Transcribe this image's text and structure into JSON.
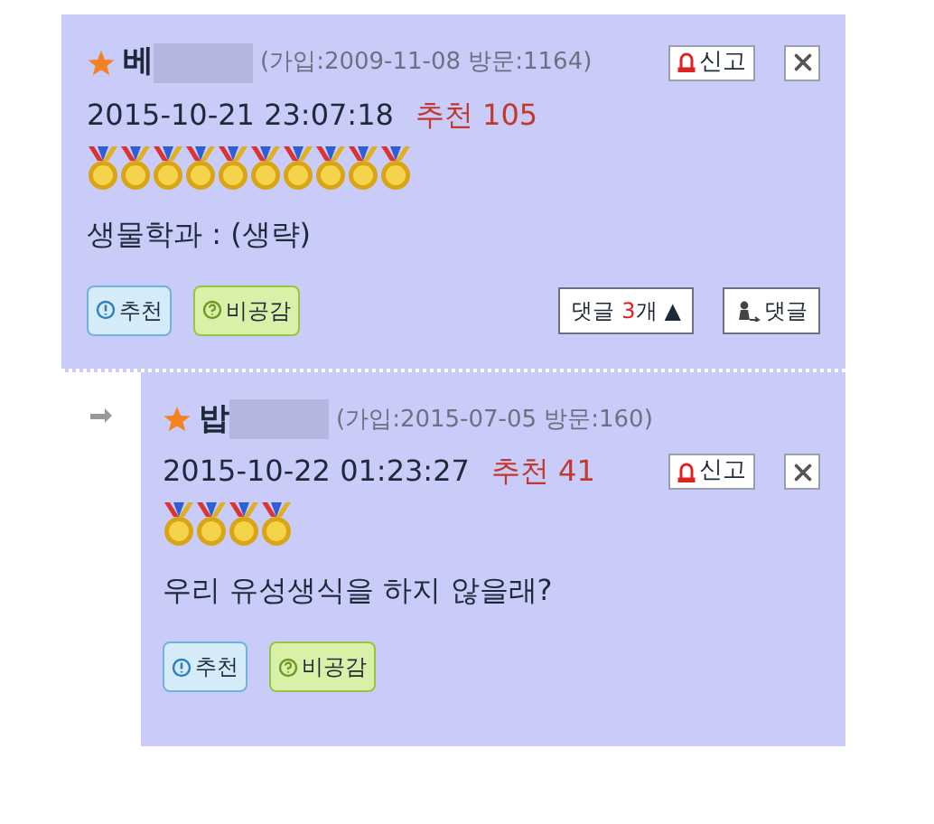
{
  "comments": [
    {
      "author": "베",
      "joined": "(가입:2009-11-08 방문:1164)",
      "datetime": "2015-10-21 23:07:18",
      "recommend_label": "추천 105",
      "medals": [
        {
          "kind": "medal"
        },
        {
          "kind": "medal"
        },
        {
          "kind": "medal"
        },
        {
          "kind": "medal"
        },
        {
          "kind": "medal"
        },
        {
          "kind": "medal"
        },
        {
          "kind": "medal"
        },
        {
          "kind": "medal"
        },
        {
          "kind": "medal"
        },
        {
          "kind": "medal"
        }
      ],
      "body": "생물학과 : (생략)",
      "report": "신고",
      "upvote": "추천",
      "downvote": "비공감",
      "reply_count": {
        "label": "댓글",
        "count": "3",
        "unit": "개",
        "arrow": "▲"
      },
      "reply_button": "댓글"
    },
    {
      "author": "밥",
      "joined": "(가입:2015-07-05 방문:160)",
      "datetime": "2015-10-22 01:23:27",
      "recommend_label": "추천 41",
      "medals": [
        {
          "kind": "medal"
        },
        {
          "kind": "medal"
        },
        {
          "kind": "medal"
        },
        {
          "kind": "medal"
        }
      ],
      "body": "우리 유성생식을 하지 않을래?",
      "report": "신고",
      "upvote": "추천",
      "downvote": "비공감"
    }
  ]
}
